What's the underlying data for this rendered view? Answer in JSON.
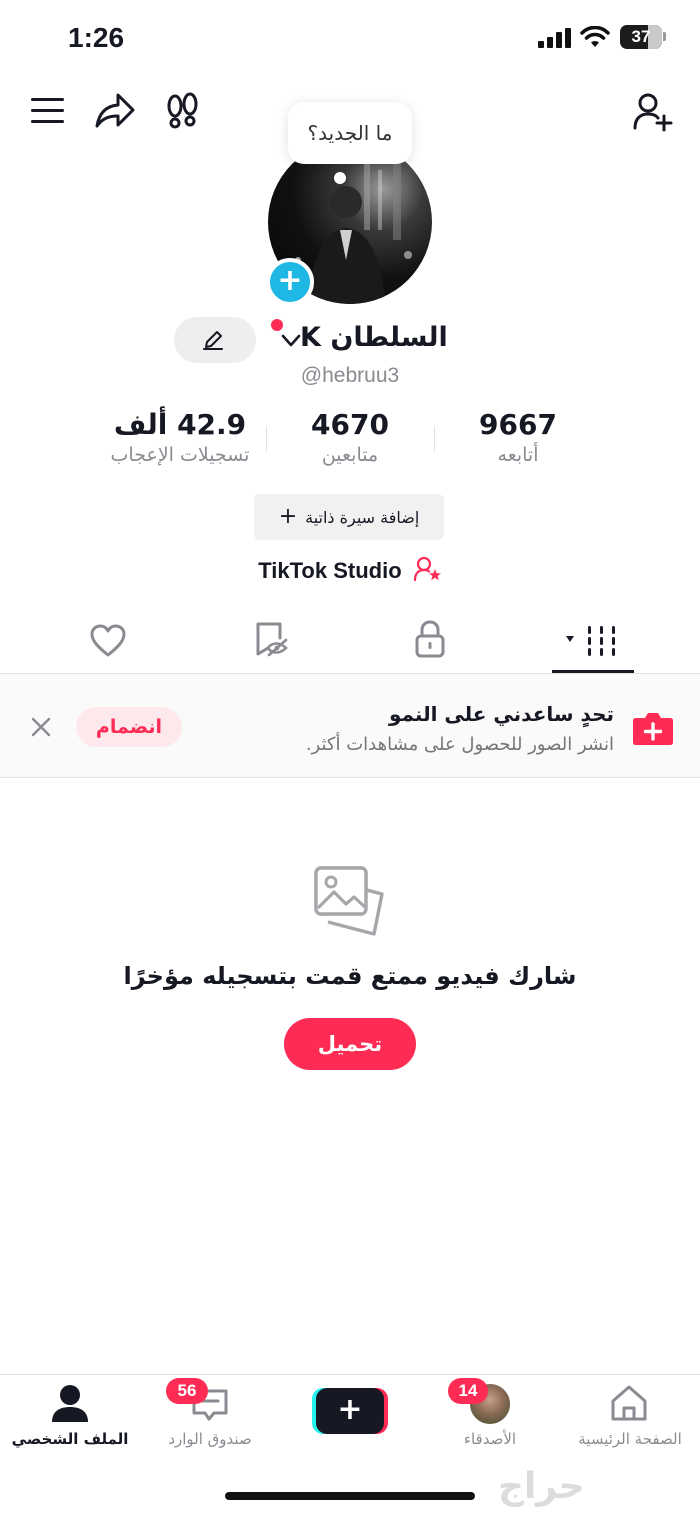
{
  "status_bar": {
    "time": "1:26",
    "battery": "37"
  },
  "bubble": {
    "text": "ما الجديد؟"
  },
  "profile": {
    "display_name": "السلطان K",
    "handle": "@hebruu3"
  },
  "stats": {
    "following": {
      "value": "9667",
      "label": "أتابعه"
    },
    "followers": {
      "value": "4670",
      "label": "متابعين"
    },
    "likes": {
      "value": "42.9 ألف",
      "label": "تسجيلات الإعجاب"
    }
  },
  "bio_button": {
    "label": "إضافة سيرة ذاتية",
    "icon": "plus-icon"
  },
  "studio": {
    "label": "TikTok Studio",
    "icon": "user-star-icon"
  },
  "tabs": [
    {
      "name": "videos",
      "icon": "grid-icon",
      "active": true
    },
    {
      "name": "private",
      "icon": "lock-icon"
    },
    {
      "name": "reposts",
      "icon": "eye-slash-icon"
    },
    {
      "name": "liked",
      "icon": "heart-icon"
    }
  ],
  "challenge": {
    "title": "تحدٍ ساعدني على النمو",
    "subtitle": "انشر الصور للحصول على مشاهدات أكثر.",
    "join_label": "انضمام"
  },
  "empty_state": {
    "title": "شارك فيديو ممتع قمت بتسجيله مؤخرًا",
    "upload_label": "تحميل"
  },
  "bottom_nav": {
    "home": "الصفحة الرئيسية",
    "friends": "الأصدقاء",
    "friends_badge": "14",
    "inbox": "صندوق الوارد",
    "inbox_badge": "56",
    "profile": "الملف الشخصي"
  },
  "watermark": "حراج",
  "colors": {
    "accent": "#fe2c55",
    "cyan": "#25f4ee",
    "plus_blue": "#1fb7e4"
  }
}
